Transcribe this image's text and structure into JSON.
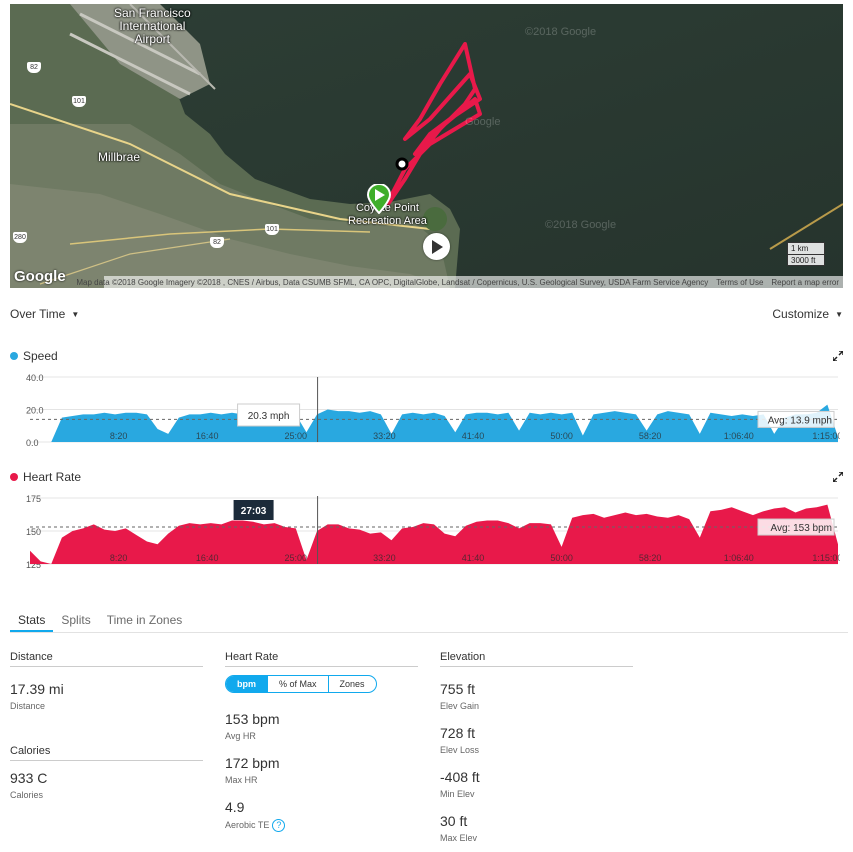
{
  "map": {
    "labels": {
      "airport": "San Francisco\nInternational\nAirport",
      "millbrae": "Millbrae",
      "park": "Coyote Point\nRecreation Area"
    },
    "watermarks": [
      "©2018 Google",
      "Google",
      "©2018 Google"
    ],
    "road_shields": [
      "82",
      "101",
      "280",
      "82",
      "101"
    ],
    "google_logo": "Google",
    "attribution": "Map data ©2018 Google Imagery ©2018 , CNES / Airbus, Data CSUMB SFML, CA OPC, DigitalGlobe, Landsat / Copernicus, U.S. Geological Survey, USDA Farm Service Agency",
    "terms": "Terms of Use",
    "report": "Report a map error",
    "scale_km": "1 km",
    "scale_ft": "3000 ft",
    "track_color": "#e8194a"
  },
  "toolbar": {
    "view": "Over Time",
    "customize": "Customize"
  },
  "speed": {
    "title": "Speed",
    "color": "#29a8e0",
    "tooltip": "20.3 mph",
    "avg_label": "Avg: 13.9 mph",
    "y_ticks": [
      "40.0",
      "20.0",
      "0.0"
    ]
  },
  "heart_rate": {
    "title": "Heart Rate",
    "color": "#e8194a",
    "time_flag": "27:03",
    "avg_label": "Avg: 153 bpm",
    "y_ticks": [
      "175",
      "150",
      "125"
    ]
  },
  "x_ticks": [
    "8:20",
    "16:40",
    "25:00",
    "33:20",
    "41:40",
    "50:00",
    "58:20",
    "1:06:40",
    "1:15:00"
  ],
  "chart_data": [
    {
      "type": "area",
      "title": "Speed",
      "ylim": [
        0,
        40
      ],
      "x_unit": "minutes",
      "xlim": [
        0,
        76
      ],
      "cursor_x": 27.05,
      "avg": 13.9,
      "x": [
        0,
        1,
        2,
        3,
        4,
        5,
        6,
        7,
        8,
        9,
        10,
        11,
        12,
        13,
        14,
        15,
        16,
        17,
        18,
        19,
        20,
        21,
        22,
        23,
        24,
        25,
        26,
        27,
        28,
        29,
        30,
        31,
        32,
        33,
        34,
        35,
        36,
        37,
        38,
        39,
        40,
        41,
        42,
        43,
        44,
        45,
        46,
        47,
        48,
        49,
        50,
        51,
        52,
        53,
        54,
        55,
        56,
        57,
        58,
        59,
        60,
        61,
        62,
        63,
        64,
        65,
        66,
        67,
        68,
        69,
        70,
        71,
        72,
        73,
        74,
        75,
        76
      ],
      "y": [
        0,
        0,
        0,
        15,
        16,
        17,
        17,
        18,
        17,
        18,
        18,
        17,
        8,
        5,
        15,
        17,
        17,
        18,
        17,
        18,
        17,
        16,
        17,
        16,
        17,
        17,
        6,
        17,
        20,
        19,
        19,
        18,
        19,
        17,
        5,
        17,
        18,
        17,
        18,
        16,
        6,
        17,
        18,
        18,
        17,
        18,
        7,
        18,
        17,
        18,
        17,
        18,
        4,
        17,
        18,
        19,
        18,
        17,
        7,
        17,
        19,
        18,
        17,
        5,
        18,
        17,
        16,
        17,
        16,
        17,
        5,
        15,
        17,
        17,
        18,
        23,
        3
      ]
    },
    {
      "type": "area",
      "title": "Heart Rate",
      "ylim": [
        125,
        175
      ],
      "x_unit": "minutes",
      "xlim": [
        0,
        76
      ],
      "cursor_x": 27.05,
      "avg": 153,
      "x": [
        0,
        1,
        2,
        3,
        4,
        5,
        6,
        7,
        8,
        9,
        10,
        11,
        12,
        13,
        14,
        15,
        16,
        17,
        18,
        19,
        20,
        21,
        22,
        23,
        24,
        25,
        26,
        27,
        28,
        29,
        30,
        31,
        32,
        33,
        34,
        35,
        36,
        37,
        38,
        39,
        40,
        41,
        42,
        43,
        44,
        45,
        46,
        47,
        48,
        49,
        50,
        51,
        52,
        53,
        54,
        55,
        56,
        57,
        58,
        59,
        60,
        61,
        62,
        63,
        64,
        65,
        66,
        67,
        68,
        69,
        70,
        71,
        72,
        73,
        74,
        75,
        76
      ],
      "y": [
        135,
        127,
        122,
        145,
        150,
        152,
        155,
        151,
        150,
        152,
        147,
        142,
        140,
        148,
        154,
        156,
        155,
        156,
        155,
        158,
        158,
        157,
        155,
        156,
        153,
        152,
        128,
        150,
        155,
        155,
        152,
        151,
        148,
        149,
        143,
        152,
        153,
        156,
        155,
        148,
        146,
        154,
        157,
        158,
        158,
        156,
        152,
        156,
        156,
        155,
        138,
        160,
        162,
        163,
        160,
        162,
        164,
        162,
        163,
        161,
        160,
        162,
        159,
        145,
        165,
        166,
        168,
        165,
        162,
        165,
        167,
        168,
        164,
        167,
        168,
        170,
        140
      ]
    }
  ],
  "tabs": [
    "Stats",
    "Splits",
    "Time in Zones"
  ],
  "stats": {
    "distance_head": "Distance",
    "distance_val": "17.39 mi",
    "distance_lbl": "Distance",
    "calories_head": "Calories",
    "calories_val": "933 C",
    "calories_lbl": "Calories",
    "hr_head": "Heart Rate",
    "hr_toggle": [
      "bpm",
      "% of Max",
      "Zones"
    ],
    "avg_hr_val": "153 bpm",
    "avg_hr_lbl": "Avg HR",
    "max_hr_val": "172 bpm",
    "max_hr_lbl": "Max HR",
    "te_val": "4.9",
    "te_lbl": "Aerobic TE",
    "elev_head": "Elevation",
    "gain_val": "755 ft",
    "gain_lbl": "Elev Gain",
    "loss_val": "728 ft",
    "loss_lbl": "Elev Loss",
    "min_val": "-408 ft",
    "min_lbl": "Min Elev",
    "max_val": "30 ft",
    "max_lbl": "Max Elev"
  }
}
